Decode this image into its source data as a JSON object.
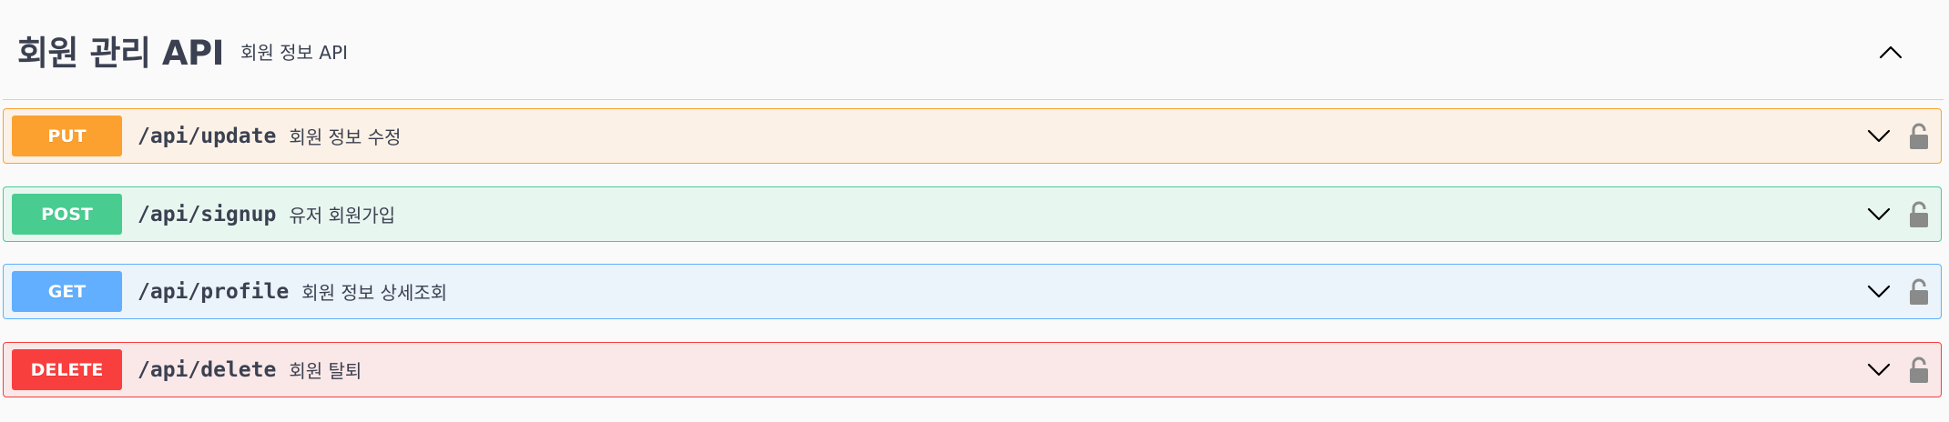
{
  "tag": {
    "title": "회원 관리 API",
    "description": "회원 정보 API",
    "collapse_icon": "chevron-up-icon"
  },
  "operations": [
    {
      "method": "PUT",
      "path": "/api/update",
      "summary": "회원 정보 수정",
      "color": "#fca130",
      "bg": "#fcf1e6",
      "expand_icon": "chevron-down-icon",
      "auth_icon": "unlocked-icon"
    },
    {
      "method": "POST",
      "path": "/api/signup",
      "summary": "유저 회원가입",
      "color": "#49cc90",
      "bg": "#e8f6f0",
      "expand_icon": "chevron-down-icon",
      "auth_icon": "unlocked-icon"
    },
    {
      "method": "GET",
      "path": "/api/profile",
      "summary": "회원 정보 상세조회",
      "color": "#61affe",
      "bg": "#ebf3fb",
      "expand_icon": "chevron-down-icon",
      "auth_icon": "unlocked-icon"
    },
    {
      "method": "DELETE",
      "path": "/api/delete",
      "summary": "회원 탈퇴",
      "color": "#f93e3e",
      "bg": "#fae7e7",
      "expand_icon": "chevron-down-icon",
      "auth_icon": "unlocked-icon"
    }
  ]
}
